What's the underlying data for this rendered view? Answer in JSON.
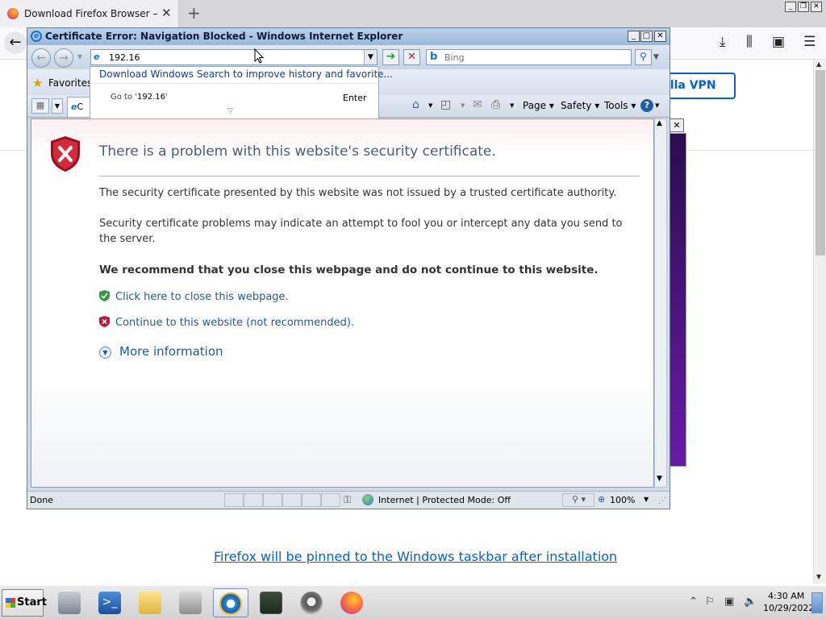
{
  "firefox": {
    "tab_title": "Download Firefox Browser — Fast",
    "vpn_button": "illa VPN",
    "pinned_link": "Firefox will be pinned to the Windows taskbar after installation"
  },
  "ie": {
    "window_title": "Certificate Error: Navigation Blocked - Windows Internet Explorer",
    "address_value": "192.16",
    "search_placeholder": "Bing",
    "favorites_label": "Favorites",
    "tab_label": "C",
    "autocomplete": {
      "suggestion": "Download Windows Search to improve history and favorite...",
      "goto_prefix": "Go to '",
      "goto_value": "192.16",
      "goto_suffix": "'",
      "enter_label": "Enter"
    },
    "command_bar": {
      "page": "Page",
      "safety": "Safety",
      "tools": "Tools"
    },
    "content": {
      "title": "There is a problem with this website's security certificate.",
      "para1": "The security certificate presented by this website was not issued by a trusted certificate authority.",
      "para2": "Security certificate problems may indicate an attempt to fool you or intercept any data you send to the server.",
      "recommend": "We recommend that you close this webpage and do not continue to this website.",
      "close_link": "Click here to close this webpage.",
      "continue_link": "Continue to this website (not recommended).",
      "more_info": "More information"
    },
    "status": {
      "text": "Done",
      "zone": "Internet | Protected Mode: Off",
      "zoom": "100%"
    }
  },
  "taskbar": {
    "start_label": "Start",
    "time": "4:30 AM",
    "date": "10/29/2022"
  },
  "colors": {
    "link_blue": "#1d5a9b",
    "firefox_link": "#0060df",
    "shield_red": "#c8102e"
  }
}
